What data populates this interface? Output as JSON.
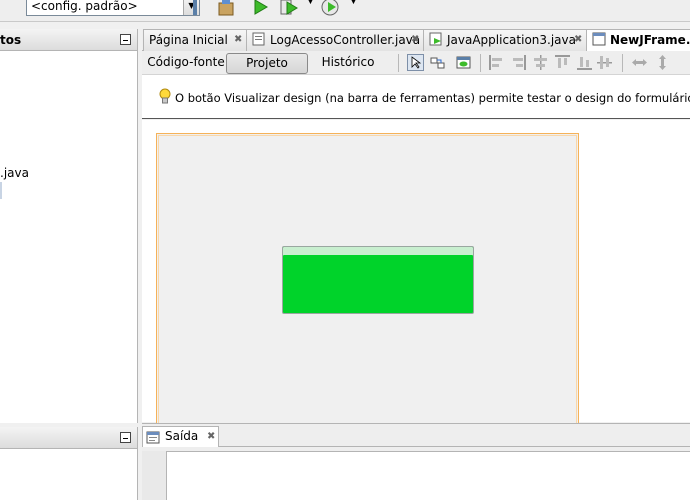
{
  "toolbar": {
    "config_value": "<config. padrão>"
  },
  "left_pane": {
    "top_title": "tos",
    "tree_item": ".java"
  },
  "editor_tabs": [
    {
      "label": "Página Inicial"
    },
    {
      "label": "LogAcessoController.java"
    },
    {
      "label": "JavaApplication3.java"
    },
    {
      "label": "NewJFrame.java"
    }
  ],
  "view_modes": {
    "source": "Código-fonte",
    "design": "Projeto",
    "history": "Histórico",
    "selected": "Projeto"
  },
  "hint": "O botão Visualizar design (na barra de ferramentas) permite testar o design do formulário.",
  "output_tab": "Saída",
  "colors": {
    "button_green": "#00d32a",
    "frame_border": "#f5b259"
  },
  "icons": [
    "lightbulb-icon",
    "run-icon",
    "debug-icon",
    "profile-icon",
    "close-icon",
    "minimize-icon"
  ]
}
